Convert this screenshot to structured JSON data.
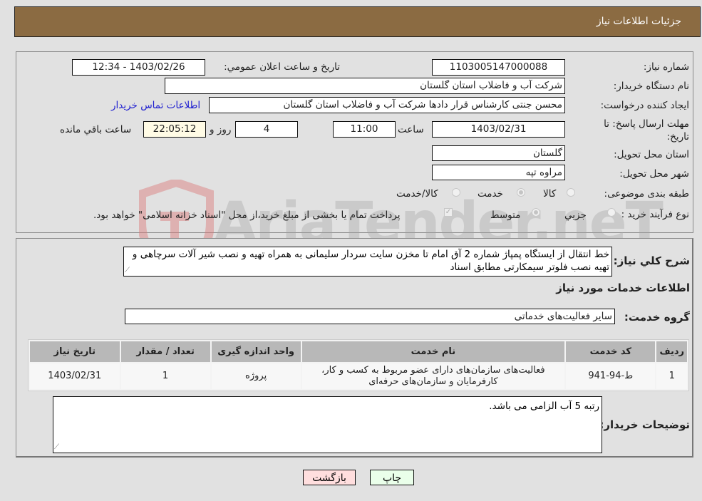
{
  "header": {
    "title": "جزئیات اطلاعات نیاز"
  },
  "fields": {
    "need_number": {
      "label": "شماره نیاز:",
      "value": "1103005147000088"
    },
    "announce_datetime": {
      "label": "تاریخ و ساعت اعلان عمومي:",
      "value": "1403/02/26 - 12:34"
    },
    "buyer_org": {
      "label": "نام دستگاه خریدار:",
      "value": "شرکت آب و فاضلاب استان گلستان"
    },
    "requester": {
      "label": "ایجاد کننده درخواست:",
      "value": "محسن جنتی کارشناس قرار دادها شرکت آب و فاضلاب استان گلستان"
    },
    "buyer_contact_link": "اطلاعات تماس خریدار",
    "deadline": {
      "label": "مهلت ارسال پاسخ: تا تاریخ:",
      "date": "1403/02/31",
      "time_label": "ساعت",
      "time": "11:00",
      "days": "4",
      "days_label": "روز و",
      "remaining": "22:05:12",
      "remaining_label": "ساعت باقي مانده"
    },
    "delivery_province": {
      "label": "استان محل تحویل:",
      "value": "گلستان"
    },
    "delivery_city": {
      "label": "شهر محل تحویل:",
      "value": "مراوه تپه"
    },
    "category": {
      "label": "طبقه بندی موضوعی:",
      "options": [
        "کالا",
        "خدمت",
        "کالا/خدمت"
      ],
      "selected": "خدمت"
    },
    "purchase_type": {
      "label": "نوع فرآیند خرید :",
      "options": [
        "جزيي",
        "متوسط"
      ],
      "selected": "متوسط",
      "treasury_checkbox_checked": true,
      "treasury_note": "پرداخت تمام یا بخشی از مبلغ خرید،از محل \"اسناد خزانه اسلامی\" خواهد بود."
    }
  },
  "description": {
    "label": "شرح کلي نیاز:",
    "value": "خط انتقال از ایستگاه پمپاژ شماره 2 آق امام تا مخزن سایت سردار سلیمانی به همراه تهیه و نصب شیر آلات سرچاهی و تهیه نصب فلوتر سیمکارتی مطابق اسناد"
  },
  "services": {
    "section_title": "اطلاعات خدمات مورد نیاز",
    "group_label": "گروه خدمت:",
    "group_value": "سایر فعالیت‌های خدماتی",
    "columns": [
      "ردیف",
      "کد خدمت",
      "نام خدمت",
      "واحد اندازه گیری",
      "تعداد / مقدار",
      "تاریخ نیاز"
    ],
    "rows": [
      {
        "row": "1",
        "code": "ط-94-941",
        "name": "فعالیت‌های سازمان‌های دارای عضو مربوط به کسب و کار، کارفرمایان و سازمان‌های حرفه‌ای",
        "unit": "پروژه",
        "quantity": "1",
        "date": "1403/02/31"
      }
    ]
  },
  "buyer_notes": {
    "label": "توضیحات خریدار:",
    "value": "رتبه 5 آب الزامی می باشد."
  },
  "buttons": {
    "print": "چاپ",
    "back": "بازگشت"
  },
  "watermark": "AriaTender.neT"
}
